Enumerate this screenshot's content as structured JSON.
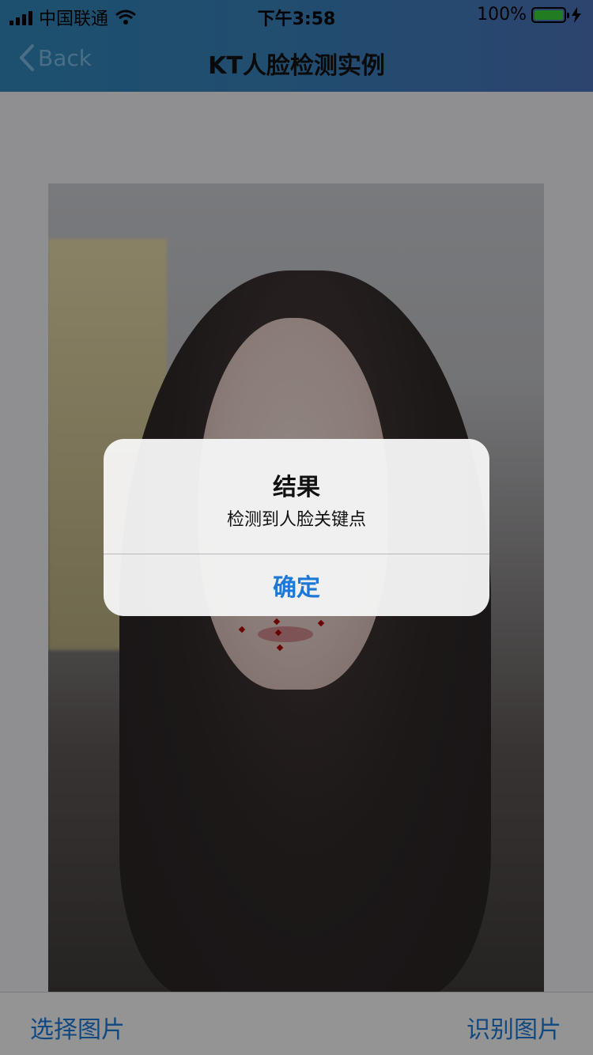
{
  "status_bar": {
    "carrier": "中国联通",
    "time": "下午3:58",
    "battery_percent": "100%",
    "battery_level": 1.0,
    "icons": [
      "signal-icon",
      "wifi-icon",
      "battery-icon",
      "charging-icon"
    ]
  },
  "navbar": {
    "back_label": "Back",
    "title": "KT人脸检测实例"
  },
  "photo": {
    "keypoints_count": 6
  },
  "alert": {
    "title": "结果",
    "message": "检测到人脸关键点",
    "ok_label": "确定"
  },
  "toolbar": {
    "select_label": "选择图片",
    "recognize_label": "识别图片"
  },
  "colors": {
    "accent": "#1e78d6",
    "nav_start": "#2f86b8",
    "nav_end": "#4a72b8",
    "keypoint": "#b20000"
  }
}
